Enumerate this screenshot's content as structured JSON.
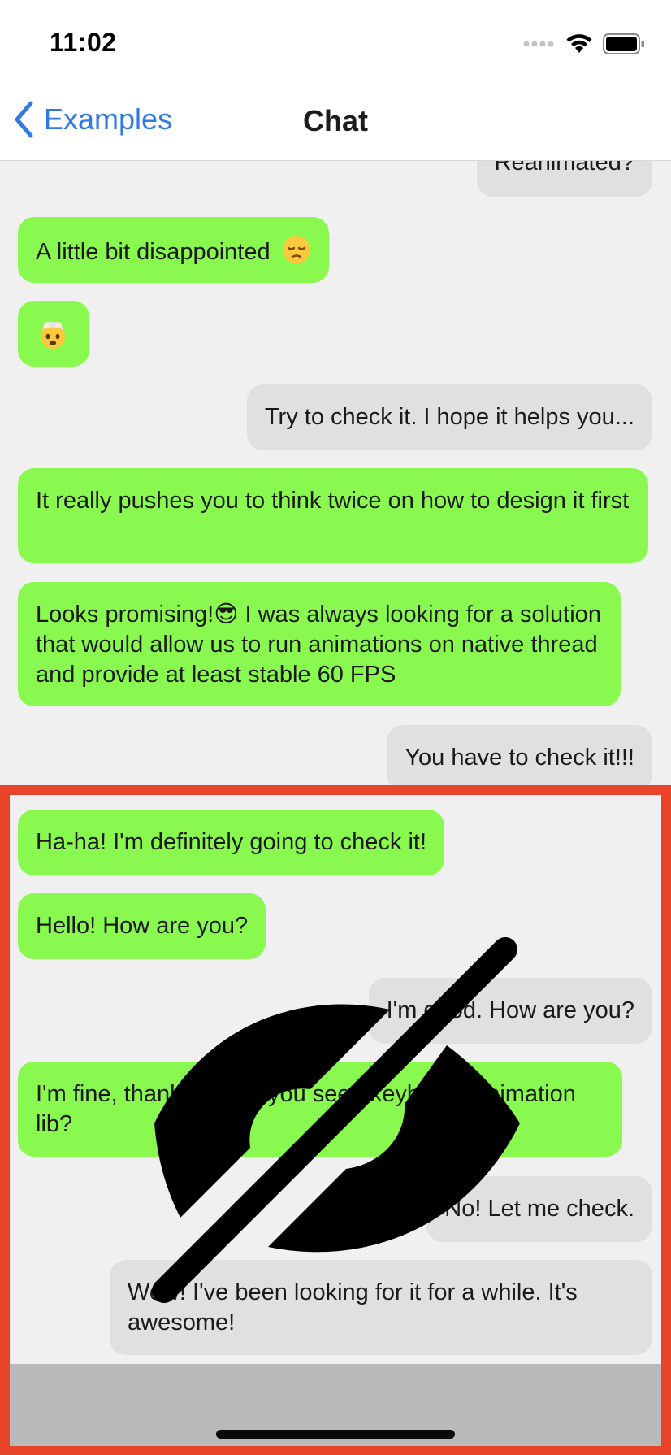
{
  "status_bar": {
    "time": "11:02"
  },
  "nav": {
    "back_label": "Examples",
    "title": "Chat"
  },
  "messages": [
    {
      "side": "right",
      "text": "Reanimated?"
    },
    {
      "side": "left",
      "text": "A little bit disappointed",
      "emoji": "pensive-face"
    },
    {
      "side": "left",
      "text": "",
      "emoji": "exploding-head"
    },
    {
      "side": "right",
      "text": "Try to check it. I hope it helps you..."
    },
    {
      "side": "left",
      "text": "It really pushes you to think twice on how to design it first"
    },
    {
      "side": "left",
      "text": "Looks promising!😎 I was always looking for a solution that would allow us to run animations on native thread and provide at least stable 60 FPS"
    },
    {
      "side": "right",
      "text": "You have to check it!!!"
    },
    {
      "side": "left",
      "text": "Ha-ha! I'm definitely going to check it!"
    },
    {
      "side": "left",
      "text": "Hello! How are you?"
    },
    {
      "side": "right",
      "text": "I'm good. How are you?"
    },
    {
      "side": "left",
      "text": "I'm fine, thanks! Have you seen keyboard animation lib?"
    },
    {
      "side": "right",
      "text": "No! Let me check."
    },
    {
      "side": "right",
      "text": "Wow! I've been looking for it for a while. It's awesome!"
    }
  ],
  "colors": {
    "incoming_bubble": "#89f94f",
    "outgoing_bubble": "#e0e0e0",
    "accent": "#2f7ae5",
    "highlight_frame": "#e8442a",
    "keyboard_area": "#bababa"
  },
  "overlay": {
    "icon": "eye-slash-icon"
  }
}
